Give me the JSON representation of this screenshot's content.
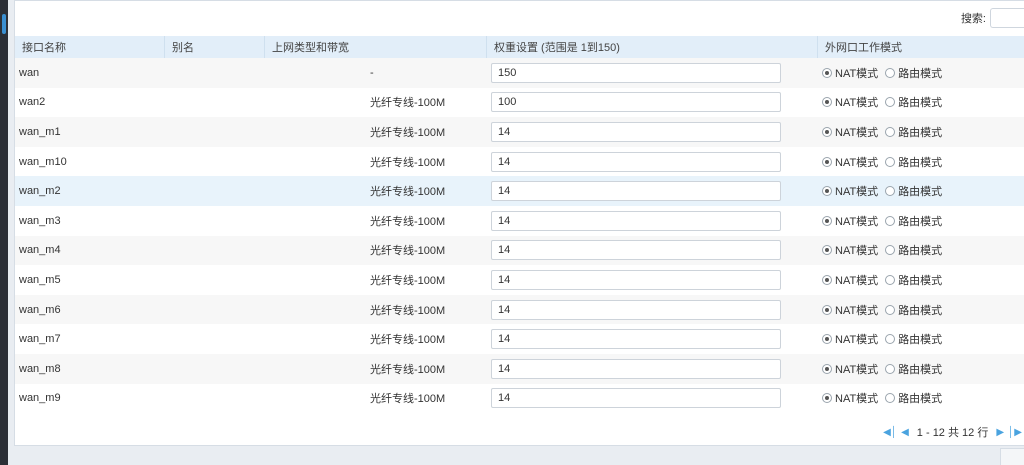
{
  "search": {
    "label": "搜索:",
    "value": ""
  },
  "columns": {
    "name": "接口名称",
    "alias": "别名",
    "uplink": "上网类型和带宽",
    "weight": "权重设置 (范围是 1到150)",
    "mode": "外网口工作模式"
  },
  "mode_labels": {
    "nat": "NAT模式",
    "route": "路由模式"
  },
  "rows": [
    {
      "name": "wan",
      "alias": "",
      "uplink": "-",
      "weight": "150",
      "mode": "nat"
    },
    {
      "name": "wan2",
      "alias": "",
      "uplink": "光纤专线-100M",
      "weight": "100",
      "mode": "nat"
    },
    {
      "name": "wan_m1",
      "alias": "",
      "uplink": "光纤专线-100M",
      "weight": "14",
      "mode": "nat"
    },
    {
      "name": "wan_m10",
      "alias": "",
      "uplink": "光纤专线-100M",
      "weight": "14",
      "mode": "nat"
    },
    {
      "name": "wan_m2",
      "alias": "",
      "uplink": "光纤专线-100M",
      "weight": "14",
      "mode": "nat"
    },
    {
      "name": "wan_m3",
      "alias": "",
      "uplink": "光纤专线-100M",
      "weight": "14",
      "mode": "nat"
    },
    {
      "name": "wan_m4",
      "alias": "",
      "uplink": "光纤专线-100M",
      "weight": "14",
      "mode": "nat"
    },
    {
      "name": "wan_m5",
      "alias": "",
      "uplink": "光纤专线-100M",
      "weight": "14",
      "mode": "nat"
    },
    {
      "name": "wan_m6",
      "alias": "",
      "uplink": "光纤专线-100M",
      "weight": "14",
      "mode": "nat"
    },
    {
      "name": "wan_m7",
      "alias": "",
      "uplink": "光纤专线-100M",
      "weight": "14",
      "mode": "nat"
    },
    {
      "name": "wan_m8",
      "alias": "",
      "uplink": "光纤专线-100M",
      "weight": "14",
      "mode": "nat"
    },
    {
      "name": "wan_m9",
      "alias": "",
      "uplink": "光纤专线-100M",
      "weight": "14",
      "mode": "nat"
    }
  ],
  "highlighted_row": "wan_m2",
  "pager": {
    "text": "1 - 12 共 12 行"
  },
  "colors": {
    "header_bg": "#e2eef9",
    "highlight_bg": "#e8f3fb",
    "pager_accent": "#4aa3df"
  }
}
